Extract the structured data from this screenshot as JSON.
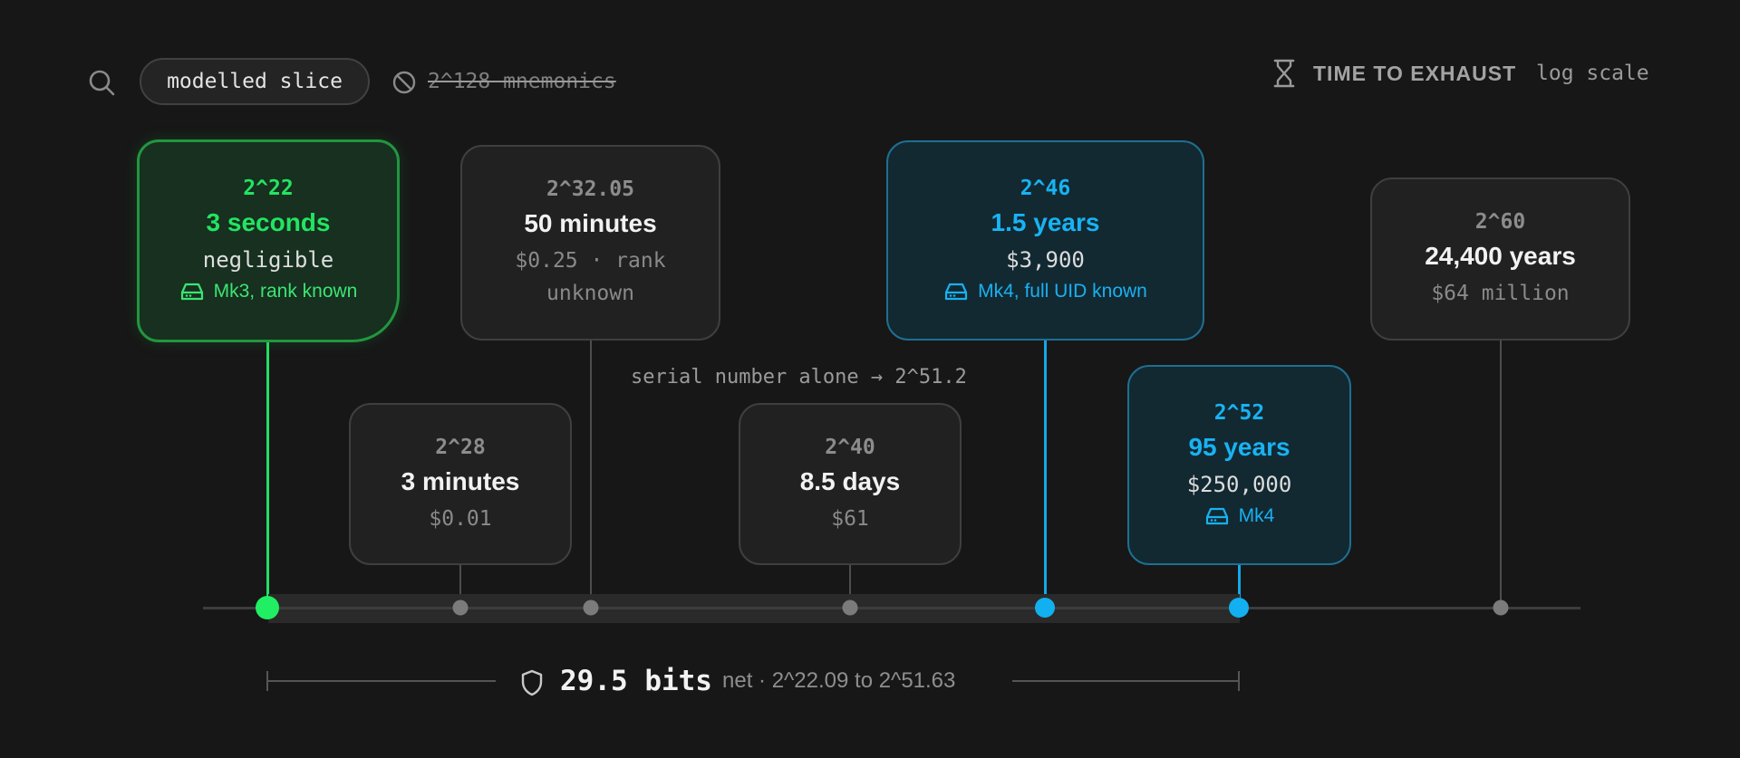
{
  "header": {
    "scope_chip": "modelled slice",
    "excluded_label": "2^128 mnemonics",
    "title": "TIME TO EXHAUST",
    "scale_label": "log scale"
  },
  "milestones": [
    {
      "exponent": "2^22",
      "duration": "3 seconds",
      "cost": "negligible",
      "device": "Mk3, rank known",
      "highlight": "green"
    },
    {
      "exponent": "2^28",
      "duration": "3 minutes",
      "cost": "$0.01"
    },
    {
      "exponent": "2^32.05",
      "duration": "50 minutes",
      "cost": "$0.25 · rank unknown"
    },
    {
      "exponent": "2^40",
      "duration": "8.5 days",
      "cost": "$61"
    },
    {
      "exponent": "2^46",
      "duration": "1.5 years",
      "cost": "$3,900",
      "device": "Mk4, full UID known",
      "highlight": "blue"
    },
    {
      "exponent": "2^52",
      "duration": "95 years",
      "cost": "$250,000",
      "device": "Mk4",
      "highlight": "blue"
    },
    {
      "exponent": "2^60",
      "duration": "24,400 years",
      "cost": "$64 million"
    }
  ],
  "annotation": "serial number alone → 2^51.2",
  "range": {
    "value": "29.5 bits",
    "note": "net · 2^22.09 to 2^51.63",
    "from_exp": 22.09,
    "to_exp": 51.63
  },
  "colors": {
    "green": "#22e063",
    "blue": "#12a9e9",
    "background": "#171717"
  },
  "icons": {
    "search": "search-icon",
    "excluded": "ban-icon",
    "title": "hourglass-icon",
    "device": "hard-drive-icon",
    "range": "shield-icon"
  }
}
